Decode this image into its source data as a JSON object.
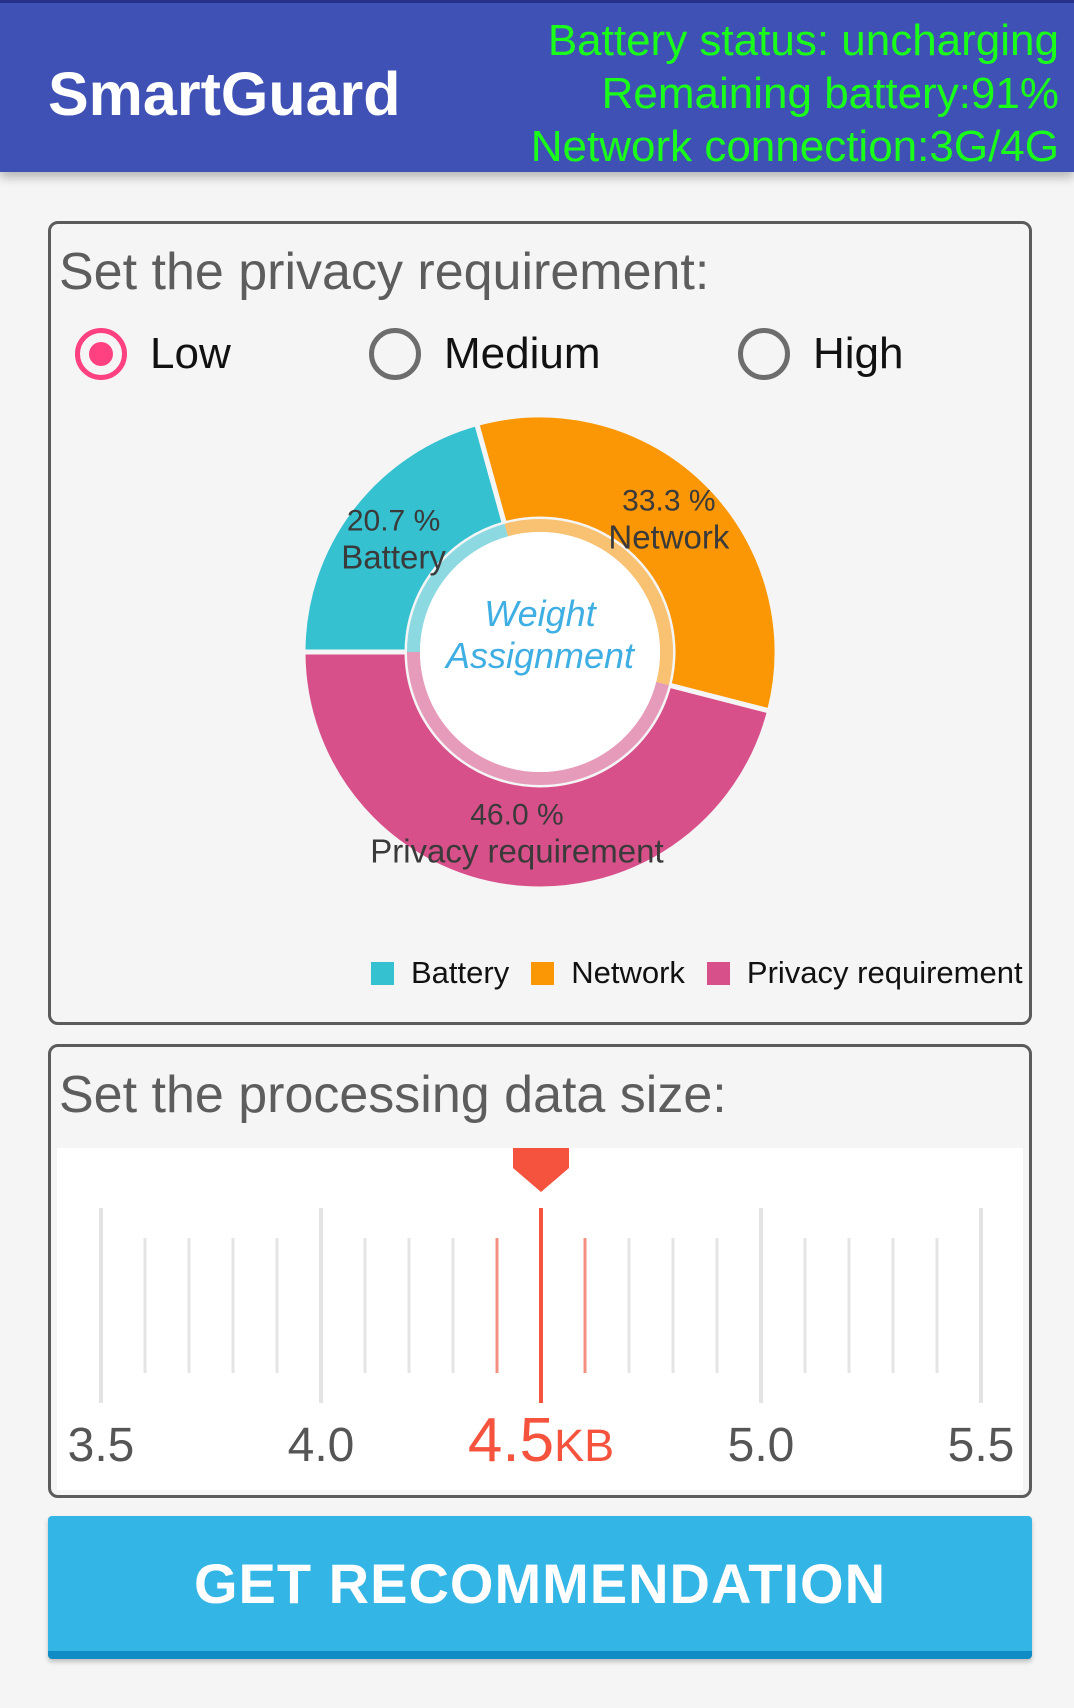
{
  "app_bar": {
    "title": "SmartGuard",
    "status_lines": [
      "Battery status: uncharging",
      "Remaining battery:91%",
      "Network connection:3G/4G"
    ],
    "status_color": "#1aff1a",
    "background_color": "#3f51b5"
  },
  "privacy_card": {
    "title": "Set the privacy requirement:",
    "options": [
      {
        "label": "Low",
        "checked": true
      },
      {
        "label": "Medium",
        "checked": false
      },
      {
        "label": "High",
        "checked": false
      }
    ],
    "accent_color": "#ff4081"
  },
  "chart_data": {
    "type": "pie",
    "center_text": [
      "Weight",
      "Assignment"
    ],
    "slices": [
      {
        "name": "Privacy requirement",
        "value": 46.0,
        "label": "46.0 %",
        "color": "#d8508a"
      },
      {
        "name": "Battery",
        "value": 20.7,
        "label": "20.7 %",
        "color": "#35c1d0"
      },
      {
        "name": "Network",
        "value": 33.3,
        "label": "33.3 %",
        "color": "#fb9705"
      }
    ],
    "legend": [
      {
        "name": "Battery",
        "color": "#35c1d0"
      },
      {
        "name": "Network",
        "color": "#fb9705"
      },
      {
        "name": "Privacy requirement",
        "color": "#d8508a"
      }
    ],
    "legend_position": "bottom-right"
  },
  "size_card": {
    "title": "Set the processing data size:",
    "ruler": {
      "min": 3.5,
      "max": 5.5,
      "step": 0.1,
      "value": 4.5,
      "unit": "KB",
      "value_label": "4.5",
      "tick_labels": [
        "3.5",
        "4.0",
        "5.0",
        "5.5"
      ],
      "accent_color": "#f5533d"
    }
  },
  "button": {
    "label": "GET RECOMMENDATION",
    "color": "#33b5e5"
  }
}
